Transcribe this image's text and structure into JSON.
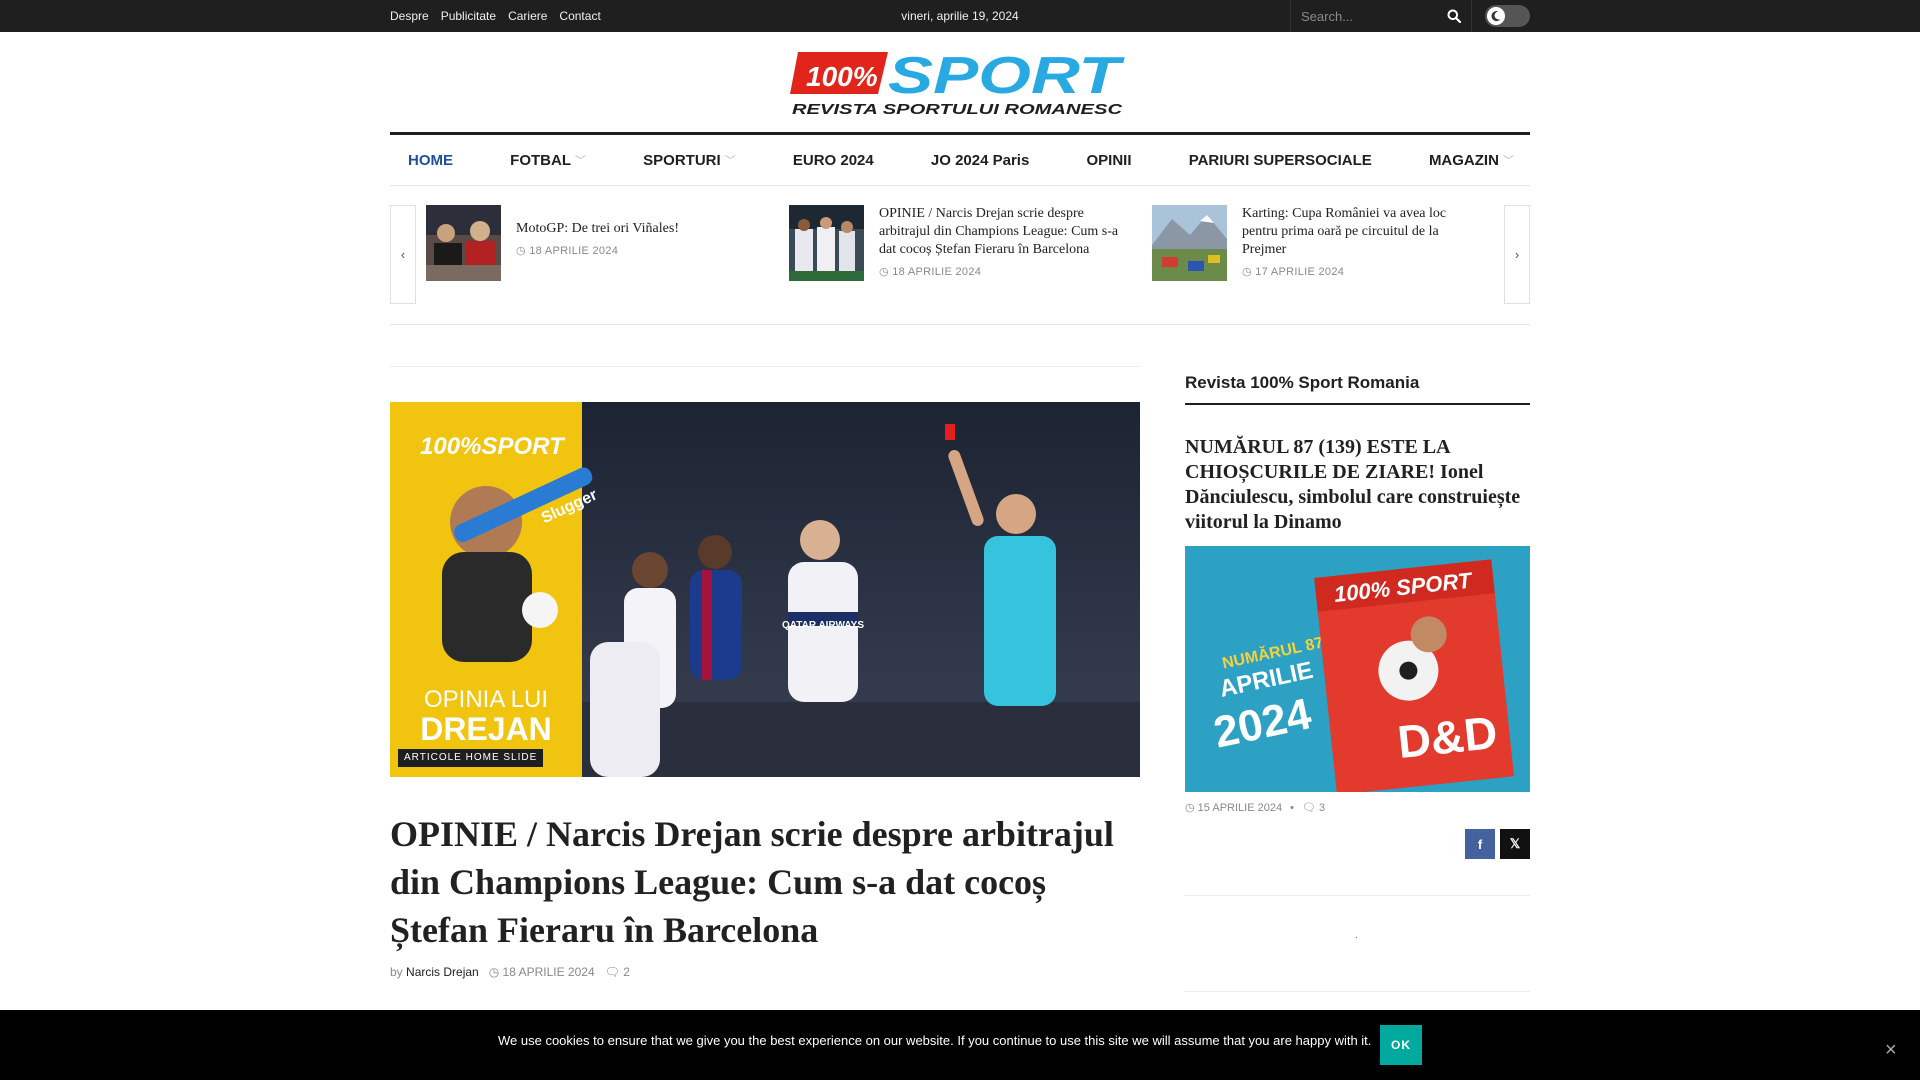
{
  "topbar": {
    "links": [
      "Despre",
      "Publicitate",
      "Cariere",
      "Contact"
    ],
    "date": "vineri, aprilie 19, 2024",
    "search_placeholder": "Search..."
  },
  "logo": {
    "main_a": "100%",
    "main_b": "SPORT",
    "tagline": "REVISTA SPORTULUI ROMANESC"
  },
  "nav": {
    "items": [
      {
        "label": "HOME",
        "active": true,
        "dropdown": false
      },
      {
        "label": "FOTBAL",
        "dropdown": true
      },
      {
        "label": "SPORTURI",
        "dropdown": true
      },
      {
        "label": "EURO 2024",
        "dropdown": false
      },
      {
        "label": "JO 2024 Paris",
        "dropdown": false
      },
      {
        "label": "OPINII",
        "dropdown": false
      },
      {
        "label": "PARIURI SUPERSOCIALE",
        "dropdown": false
      },
      {
        "label": "MAGAZIN",
        "dropdown": true
      }
    ]
  },
  "ticker": {
    "items": [
      {
        "title": "MotoGP: De trei ori Viñales!",
        "date": "18 APRILIE 2024"
      },
      {
        "title": "OPINIE / Narcis Drejan scrie despre arbitrajul din Champions League: Cum s-a dat cocoș Ștefan Fieraru în Barcelona",
        "date": "18 APRILIE 2024"
      },
      {
        "title": "Karting: Cupa României va avea loc pentru prima oară pe circuitul de la Prejmer",
        "date": "17 APRILIE 2024"
      }
    ]
  },
  "hero": {
    "badge": "ARTICOLE HOME SLIDE",
    "image_logo": "100%SPORT",
    "image_caption_small": "OPINIA LUI",
    "image_caption_big": "DREJAN",
    "image_bat_text": "Slugger",
    "image_sponsor": "QATAR AIRWAYS",
    "headline": "OPINIE / Narcis Drejan scrie despre arbitrajul din Champions League: Cum s-a dat cocoș Ștefan Fieraru în Barcelona",
    "by": "by",
    "author": "Narcis Drejan",
    "date": "18 APRILIE 2024",
    "comments": "2"
  },
  "sidebar": {
    "title": "Revista 100% Sport Romania",
    "headline": "NUMĂRUL 87 (139) ESTE LA CHIOȘCURILE DE ZIARE! Ionel Dănciulescu, simbolul care construiește viitorul la Dinamo",
    "cover": {
      "issue": "NUMĂRUL 87",
      "month": "APRILIE",
      "year": "2024",
      "mag_logo": "100% SPORT",
      "mag_big": "D&D"
    },
    "date": "15 APRILIE 2024",
    "comments": "3",
    "share_fb": "f",
    "share_x": "𝕏",
    "dot": "."
  },
  "cookie": {
    "message": "We use cookies to ensure that we give you the best experience on our website. If you continue to use this site we will assume that you are happy with it.",
    "ok": "OK",
    "close": "×"
  },
  "colors": {
    "accent_blue": "#1e4f9c",
    "logo_red": "#e1251b",
    "logo_blue": "#29a9e1",
    "ok_teal": "#00a99d",
    "topbar_bg": "#1f1f1f",
    "hero_yellow": "#f1c40f"
  }
}
